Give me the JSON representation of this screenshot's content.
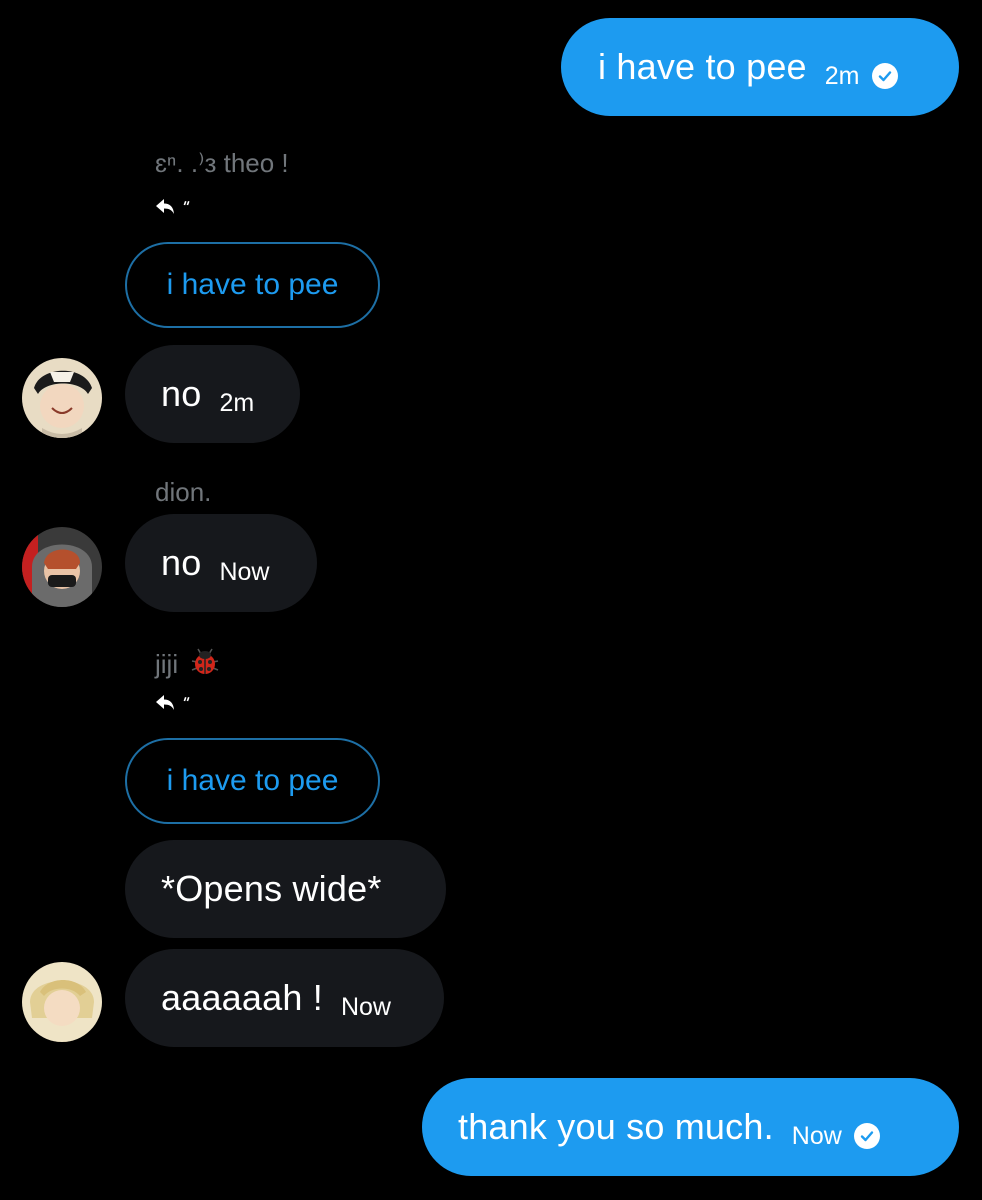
{
  "colors": {
    "background": "#000000",
    "sent_bubble": "#1d9bf0",
    "received_bubble": "#16181c",
    "accent": "#1d9bf0",
    "secondary_text": "#71767b"
  },
  "messages": {
    "m1": {
      "text": "i have to pee",
      "time": "2m",
      "status_icon": "read-check-icon"
    },
    "theo_sender": "ɛⁿ. .⁾з theo !",
    "theo_reply_icon": "reply-icon",
    "theo_quote": "i have to pee",
    "m2": {
      "text": "no",
      "time": "2m"
    },
    "dion_sender": "dion.",
    "m3": {
      "text": "no",
      "time": "Now"
    },
    "jiji_sender": "jiji",
    "jiji_emoji_icon": "ladybug-icon",
    "jiji_reply_icon": "reply-icon",
    "jiji_quote": "i have to pee",
    "m4": {
      "text": "*Opens wide*"
    },
    "m5": {
      "text": "aaaaaah !",
      "time": "Now"
    },
    "m6": {
      "text": "thank you so much.",
      "time": "Now",
      "status_icon": "read-check-icon"
    }
  }
}
